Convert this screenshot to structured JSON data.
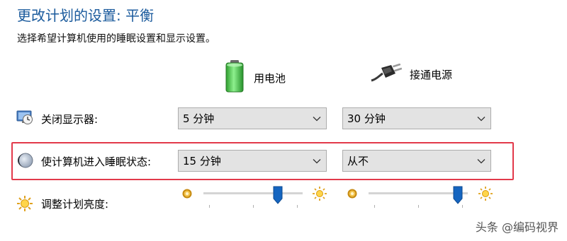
{
  "window": {
    "title": "更改计划的设置: 平衡",
    "subtitle": "选择希望计算机使用的睡眠设置和显示设置。"
  },
  "columns": {
    "battery_label": "用电池",
    "plugged_label": "接通电源"
  },
  "rows": {
    "display": {
      "label": "关闭显示器:",
      "battery_value": "5 分钟",
      "plugged_value": "30 分钟"
    },
    "sleep": {
      "label": "使计算机进入睡眠状态:",
      "battery_value": "15 分钟",
      "plugged_value": "从不"
    },
    "brightness": {
      "label": "调整计划亮度:",
      "battery_level": 0.75,
      "plugged_level": 0.9
    }
  },
  "watermark": "头条 @编码视界",
  "icons": {
    "battery": "battery-icon",
    "plug": "plug-icon",
    "display": "display-clock-icon",
    "sleep": "moon-icon",
    "brightness": "sun-icon"
  },
  "colors": {
    "title": "#1a5a9c",
    "highlight_border": "#e2394a",
    "slider_thumb": "#1565c0",
    "battery_green": "#3cbf3c"
  }
}
